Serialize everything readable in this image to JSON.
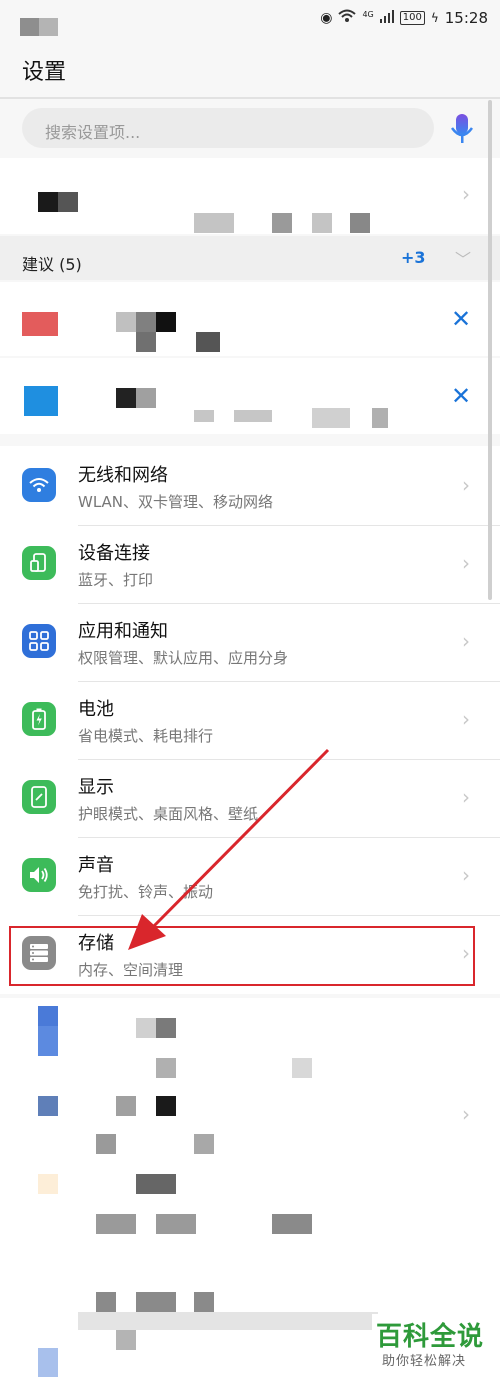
{
  "status_bar": {
    "network": "4G",
    "battery": "100",
    "time": "15:28"
  },
  "header": {
    "title": "设置"
  },
  "search": {
    "placeholder": "搜索设置项..."
  },
  "suggestions": {
    "label": "建议 (5)",
    "more": "+3"
  },
  "settings": [
    {
      "id": "wireless",
      "title": "无线和网络",
      "subtitle": "WLAN、双卡管理、移动网络",
      "icon": "wifi-icon",
      "color": "#2f7ee0"
    },
    {
      "id": "device",
      "title": "设备连接",
      "subtitle": "蓝牙、打印",
      "icon": "device-connect-icon",
      "color": "#3dbb5a"
    },
    {
      "id": "apps",
      "title": "应用和通知",
      "subtitle": "权限管理、默认应用、应用分身",
      "icon": "apps-icon",
      "color": "#2f6fd8"
    },
    {
      "id": "battery",
      "title": "电池",
      "subtitle": "省电模式、耗电排行",
      "icon": "battery-icon",
      "color": "#3dbb5a"
    },
    {
      "id": "display",
      "title": "显示",
      "subtitle": "护眼模式、桌面风格、壁纸",
      "icon": "display-icon",
      "color": "#3dbb5a"
    },
    {
      "id": "sound",
      "title": "声音",
      "subtitle": "免打扰、铃声、振动",
      "icon": "sound-icon",
      "color": "#3dbb5a"
    },
    {
      "id": "storage",
      "title": "存储",
      "subtitle": "内存、空间清理",
      "icon": "storage-icon",
      "color": "#8a8a8a"
    }
  ],
  "watermark": {
    "main": "百科全说",
    "sub": "助你轻松解决"
  }
}
